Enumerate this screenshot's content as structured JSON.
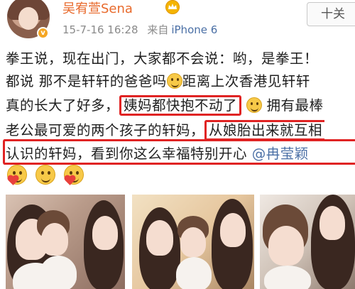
{
  "header": {
    "username": "吴宥萱Sena",
    "timestamp": "15-7-16 16:28",
    "source_prefix": "来自",
    "source": "iPhone 6",
    "follow_label": "十关"
  },
  "post": {
    "line1": "拳王说，现在出门，大家都不会说：哟，是拳王！",
    "line2_a": "都说 那不是轩轩的爸爸吗",
    "line2_b": "距离上次香港见轩轩",
    "line3_a": "真的长大了好多，",
    "line3_boxed": "姨妈都快抱不动了",
    "line3_b": "拥有最棒",
    "line4_a": "老公最可爱的两个孩子的轩妈，",
    "line4_boxed": "从娘胎出来就互相",
    "line5_a": "认识的轩妈，看到你这么幸福特别开心",
    "line5_mention": "@冉莹颖"
  },
  "icons": {
    "crown": "crown-icon",
    "verified": "verified-badge-icon",
    "emoji": "smiley-emoji-icon",
    "heart": "heart-icon"
  },
  "colors": {
    "username": "#e86a2c",
    "link": "#4a6fa5",
    "highlight_box": "#e02323",
    "badge": "#f5a623"
  }
}
